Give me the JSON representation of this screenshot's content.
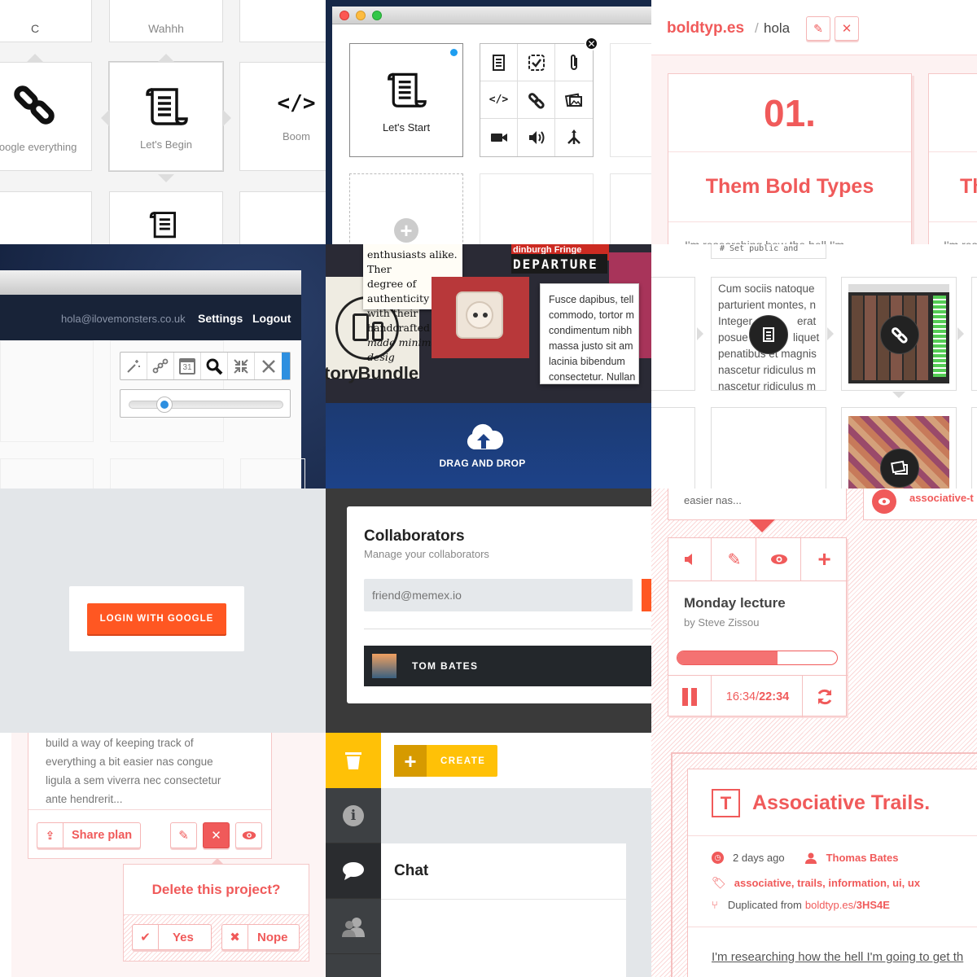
{
  "tile1": {
    "top_left_label": "C",
    "top_mid_label": "Wahhh",
    "cell_link_label": "google everything",
    "cell_begin_label": "Let's Begin",
    "cell_code_label": "Boom"
  },
  "tile2": {
    "start_label": "Let's Start"
  },
  "tile3": {
    "brand": "boldtyp.es",
    "path_sep": "/",
    "path": "hola",
    "card_number": "01.",
    "card_title": "Them Bold Types",
    "card_title_clip": "Th",
    "card_excerpt": "I'm researching how the hell I'm",
    "card_excerpt_clip": "I'm res"
  },
  "tile4": {
    "email": "hola@ilovemonsters.co.uk",
    "settings": "Settings",
    "logout": "Logout",
    "calendar_day": "31",
    "slider_value": 0.2
  },
  "tile5": {
    "quote_lines": [
      "enthusiasts alike. Ther",
      "degree of authenticity",
      "with their handcrafted",
      "made minimalist-desig"
    ],
    "story_label": "toryBundle",
    "fringe": "dinburgh Fringe",
    "departure": "DEPARTURE",
    "lorem_lines": [
      "Fusce dapibus, tell",
      "commodo, tortor m",
      "condimentum nibh",
      "massa justo sit am",
      "lacinia bibendum",
      "consectetur. Nullan"
    ],
    "drag_drop": "DRAG AND DROP"
  },
  "tile6": {
    "code_top": "# Set public and",
    "text_lines": [
      "Cum sociis natoque",
      "parturient montes, n",
      "Integer",
      "posue",
      "penatibus et magnis",
      "nascetur ridiculus m",
      "nascetur ridiculus m"
    ],
    "text_right": [
      "erat",
      "liquet"
    ]
  },
  "tile7": {
    "login": "LOGIN WITH GOOGLE"
  },
  "tile8": {
    "title": "Collaborators",
    "subtitle": "Manage your collaborators",
    "email_placeholder": "friend@memex.io",
    "collaborator": "TOM BATES"
  },
  "tile9": {
    "prev_excerpt": "easier nas...",
    "tag_clip": "associative-t",
    "title": "Monday lecture",
    "author": "by Steve Zissou",
    "progress": 0.63,
    "time_current": "16:34",
    "time_sep": "/",
    "time_total": "22:34"
  },
  "tile10": {
    "excerpt_lines": [
      "build a way of keeping track of",
      "everything a bit easier nas congue",
      "ligula a sem viverra nec consectetur",
      "ante hendrerit..."
    ],
    "share": "Share plan",
    "delete_q": "Delete this project?",
    "yes": "Yes",
    "nope": "Nope"
  },
  "tile11": {
    "create": "CREATE",
    "chat": "Chat"
  },
  "tile12": {
    "badge": "T",
    "title": "Associative Trails.",
    "time_ago": "2 days ago",
    "author": "Thomas Bates",
    "tags": "associative, trails, information, ui, ux",
    "dup_prefix": "Duplicated from",
    "dup_host": "boldtyp.es/",
    "dup_code": "3HS4E",
    "excerpt": "I'm researching how the hell I'm going to get th"
  },
  "colors": {
    "accent_red": "#f05a5a",
    "orange": "#ff5722",
    "yellow": "#ffc107",
    "dark": "#23272b"
  }
}
